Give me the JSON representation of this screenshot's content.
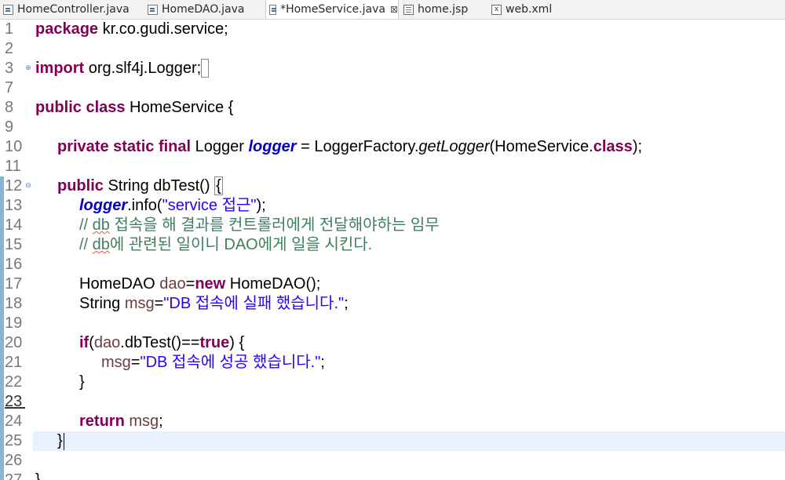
{
  "tabs": [
    {
      "label": "HomeController.java",
      "icon": "java-file-icon",
      "active": false
    },
    {
      "label": "HomeDAO.java",
      "icon": "java-file-icon",
      "active": false
    },
    {
      "label": "*HomeService.java",
      "icon": "java-file-icon",
      "active": true,
      "close": "⊠"
    },
    {
      "label": "home.jsp",
      "icon": "jsp-file-icon",
      "active": false
    },
    {
      "label": "web.xml",
      "icon": "xml-file-icon",
      "active": false
    }
  ],
  "line_numbers": [
    "1",
    "2",
    "3",
    "7",
    "8",
    "9",
    "10",
    "11",
    "12",
    "13",
    "14",
    "15",
    "16",
    "17",
    "18",
    "19",
    "20",
    "21",
    "22",
    "23",
    "24",
    "25",
    "26",
    "27"
  ],
  "code": {
    "l1_kw": "package",
    "l1_rest": " kr.co.gudi.service;",
    "l3_kw": "import",
    "l3_rest": " org.slf4j.Logger;",
    "l8_kw": "public class",
    "l8_rest": " HomeService {",
    "l10_kw": "private static final",
    "l10_type": " Logger ",
    "l10_field": "logger",
    "l10_eq": " = LoggerFactory.",
    "l10_method": "getLogger",
    "l10_arg": "(HomeService.",
    "l10_kwclass": "class",
    "l10_end": ");",
    "l12_kw": "public",
    "l12_rest": " String dbTest() ",
    "l12_brace": "{",
    "l13_field": "logger",
    "l13_call": ".info(",
    "l13_str": "\"service 접근\"",
    "l13_end": ");",
    "l14_pre": "// ",
    "l14_db": "db",
    "l14_post": " 접속을 해 결과를 컨트롤러에게 전달해야하는 임무",
    "l15_pre": "// ",
    "l15_db": "db",
    "l15_post": "에 관련된 일이니 DAO에게 일을 시킨다.",
    "l17_type": "HomeDAO ",
    "l17_var": "dao",
    "l17_eq": "=",
    "l17_kw": "new",
    "l17_rest": " HomeDAO();",
    "l18_type": "String ",
    "l18_var": "msg",
    "l18_eq": "=",
    "l18_str": "\"DB 접속에 실패 했습니다.\"",
    "l18_end": ";",
    "l20_kw": "if",
    "l20_open": "(",
    "l20_var": "dao",
    "l20_call": ".dbTest()==",
    "l20_true": "true",
    "l20_end": ") {",
    "l21_var": "msg",
    "l21_eq": "=",
    "l21_str": "\"DB 접속에 성공 했습니다.\"",
    "l21_end": ";",
    "l22": "}",
    "l24_kw": "return",
    "l24_sp": " ",
    "l24_var": "msg",
    "l24_end": ";",
    "l25": "}",
    "l27": "}"
  }
}
